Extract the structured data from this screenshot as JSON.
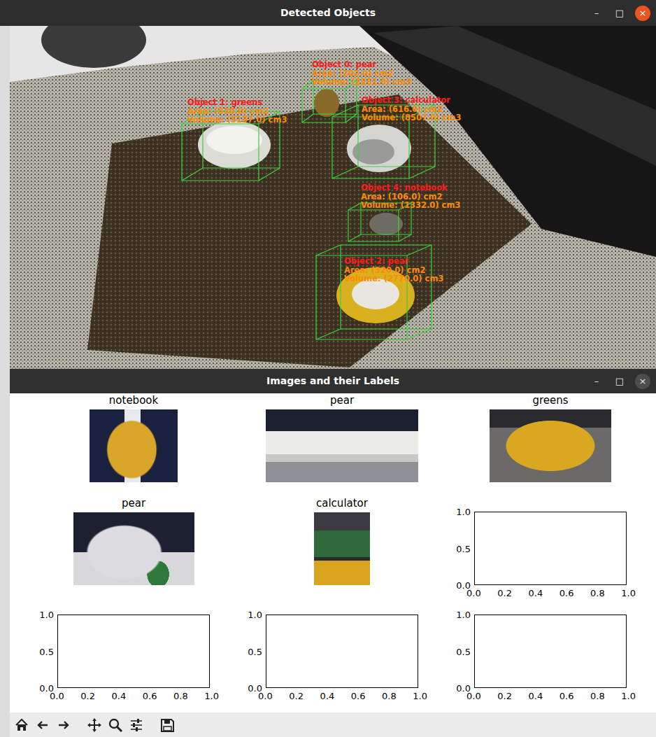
{
  "windows": [
    {
      "title": "Detected Objects",
      "focused": true,
      "controls": [
        "–",
        "□",
        "×"
      ]
    },
    {
      "title": "Images and their Labels",
      "focused": false,
      "controls": [
        "–",
        "□",
        "×"
      ]
    }
  ],
  "detections": [
    {
      "heading": "Object 0: pear",
      "area": "Area: (202.0) cm2",
      "volume": "Volume: (2261.0) cm3"
    },
    {
      "heading": "Object 1: greens",
      "area": "Area: (530.0) cm2",
      "volume": "Volume: (5137.0) cm3"
    },
    {
      "heading": "Object 2: pear",
      "area": "Area: (320.0) cm2",
      "volume": "Volume: (2770.0) cm3"
    },
    {
      "heading": "Object 3: calculator",
      "area": "Area: (616.0) cm2",
      "volume": "Volume: (8507.0) cm3"
    },
    {
      "heading": "Object 4: notebook",
      "area": "Area: (106.0) cm2",
      "volume": "Volume: (1332.0) cm3"
    }
  ],
  "figure": {
    "subplots": [
      {
        "kind": "image",
        "title": "notebook"
      },
      {
        "kind": "image",
        "title": "pear"
      },
      {
        "kind": "image",
        "title": "greens"
      },
      {
        "kind": "image",
        "title": "pear"
      },
      {
        "kind": "image",
        "title": "calculator"
      },
      {
        "kind": "empty",
        "yticks": [
          "1.0",
          "0.5",
          "0.0"
        ],
        "xticks": [
          "0.0",
          "0.2",
          "0.4",
          "0.6",
          "0.8",
          "1.0"
        ]
      },
      {
        "kind": "empty",
        "yticks": [
          "1.0",
          "0.5",
          "0.0"
        ],
        "xticks": [
          "0.0",
          "0.2",
          "0.4",
          "0.6",
          "0.8",
          "1.0"
        ]
      },
      {
        "kind": "empty",
        "yticks": [
          "1.0",
          "0.5",
          "0.0"
        ],
        "xticks": [
          "0.0",
          "0.2",
          "0.4",
          "0.6",
          "0.8",
          "1.0"
        ]
      },
      {
        "kind": "empty",
        "yticks": [
          "1.0",
          "0.5",
          "0.0"
        ],
        "xticks": [
          "0.0",
          "0.2",
          "0.4",
          "0.6",
          "0.8",
          "1.0"
        ]
      }
    ]
  }
}
